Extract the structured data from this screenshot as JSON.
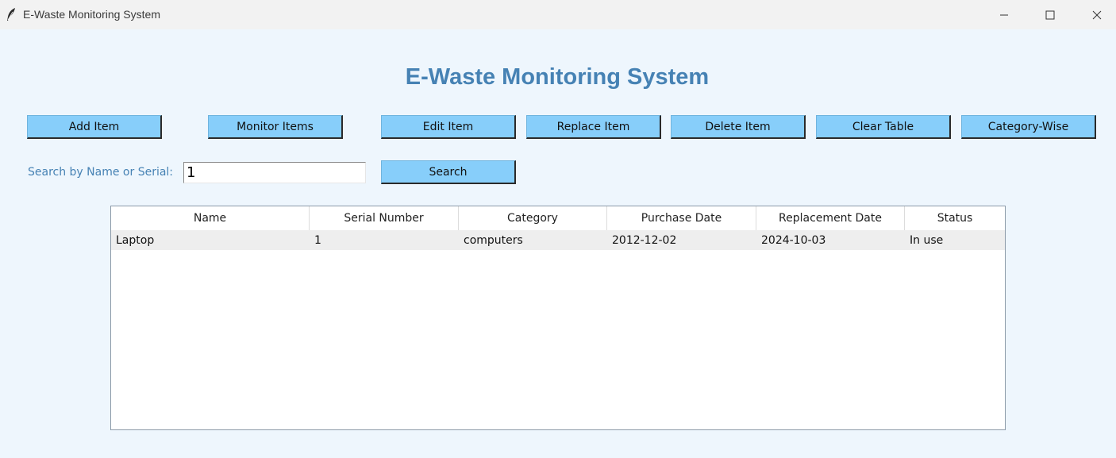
{
  "window": {
    "title": "E-Waste Monitoring System",
    "icon": "feather-icon"
  },
  "header": {
    "title": "E-Waste Monitoring System"
  },
  "toolbar": {
    "add_label": "Add Item",
    "monitor_label": "Monitor Items",
    "edit_label": "Edit Item",
    "replace_label": "Replace Item",
    "delete_label": "Delete Item",
    "clear_label": "Clear Table",
    "category_label": "Category-Wise"
  },
  "search": {
    "label": "Search by Name or Serial:",
    "value": "1",
    "button_label": "Search"
  },
  "table": {
    "columns": [
      "Name",
      "Serial Number",
      "Category",
      "Purchase Date",
      "Replacement Date",
      "Status"
    ],
    "rows": [
      [
        "Laptop",
        "1",
        "computers",
        "2012-12-02",
        "2024-10-03",
        "In use"
      ]
    ]
  },
  "colors": {
    "accent": "#4682b4",
    "button": "#87cefa",
    "background": "#eef6fd"
  }
}
